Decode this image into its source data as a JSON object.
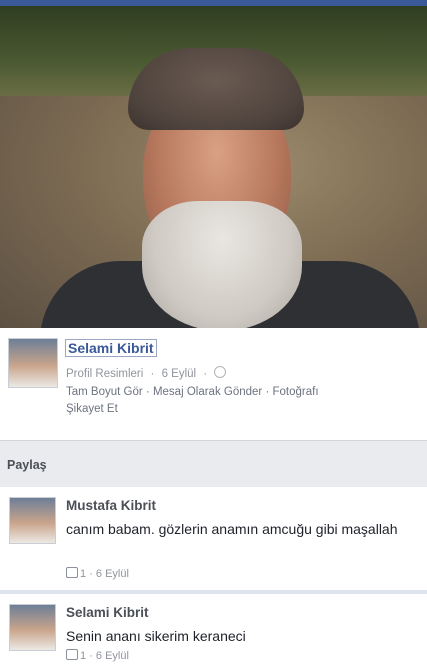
{
  "post": {
    "author": "Selami Kibrit",
    "album": "Profil Resimleri",
    "date": "6 Eylül",
    "separator": "·",
    "actions": [
      "Tam Boyut Gör",
      "Mesaj Olarak Gönder",
      "Fotoğrafı",
      "Şikayet Et"
    ]
  },
  "share": {
    "label": "Paylaş"
  },
  "comments": [
    {
      "author": "Mustafa Kibrit",
      "text": "canım babam. gözlerin anamın amcuğu gibi maşallah",
      "likes": "1",
      "date": "6 Eylül"
    },
    {
      "author": "Selami Kibrit",
      "text": "Senin ananı sikerim keraneci",
      "likes": "1",
      "date": "6 Eylül"
    }
  ],
  "colors": {
    "brand": "#3b5998",
    "meta": "#90949c",
    "bar": "#e9ebee"
  }
}
